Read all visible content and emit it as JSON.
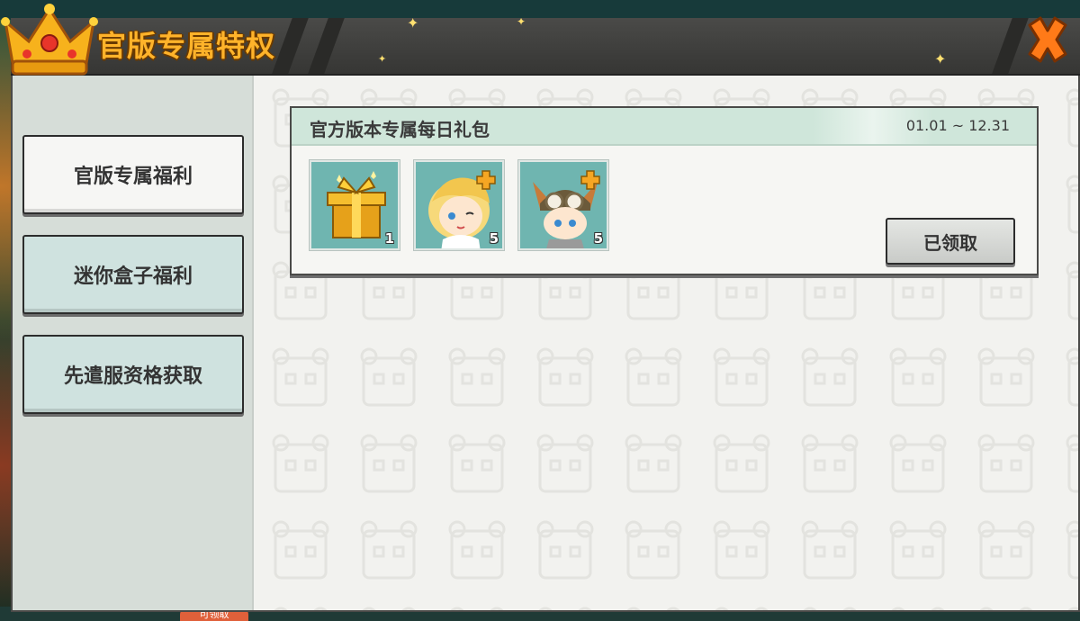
{
  "dialog": {
    "title": "官版专属特权",
    "close_icon": "close-x-icon",
    "crown_icon": "crown-icon"
  },
  "sidebar": {
    "items": [
      {
        "label": "官版专属福利",
        "active": true
      },
      {
        "label": "迷你盒子福利",
        "active": false
      },
      {
        "label": "先遣服资格获取",
        "active": false
      }
    ]
  },
  "reward_card": {
    "title": "官方版本专属每日礼包",
    "date_range": "01.01 ~ 12.31",
    "items": [
      {
        "icon": "gift-box-icon",
        "count": "1"
      },
      {
        "icon": "blonde-character-fragment-icon",
        "count": "5"
      },
      {
        "icon": "aviator-character-fragment-icon",
        "count": "5"
      }
    ],
    "claim_button": "已领取"
  },
  "background": {
    "bottom_chip": "可领取"
  },
  "colors": {
    "title": "#ffb32a",
    "close": "#ff7a18",
    "header": "#3f3f3d",
    "card_header": "#cfe6da",
    "item_bg": "#6fb5b0",
    "sidebar_inactive": "#cfe2df"
  }
}
